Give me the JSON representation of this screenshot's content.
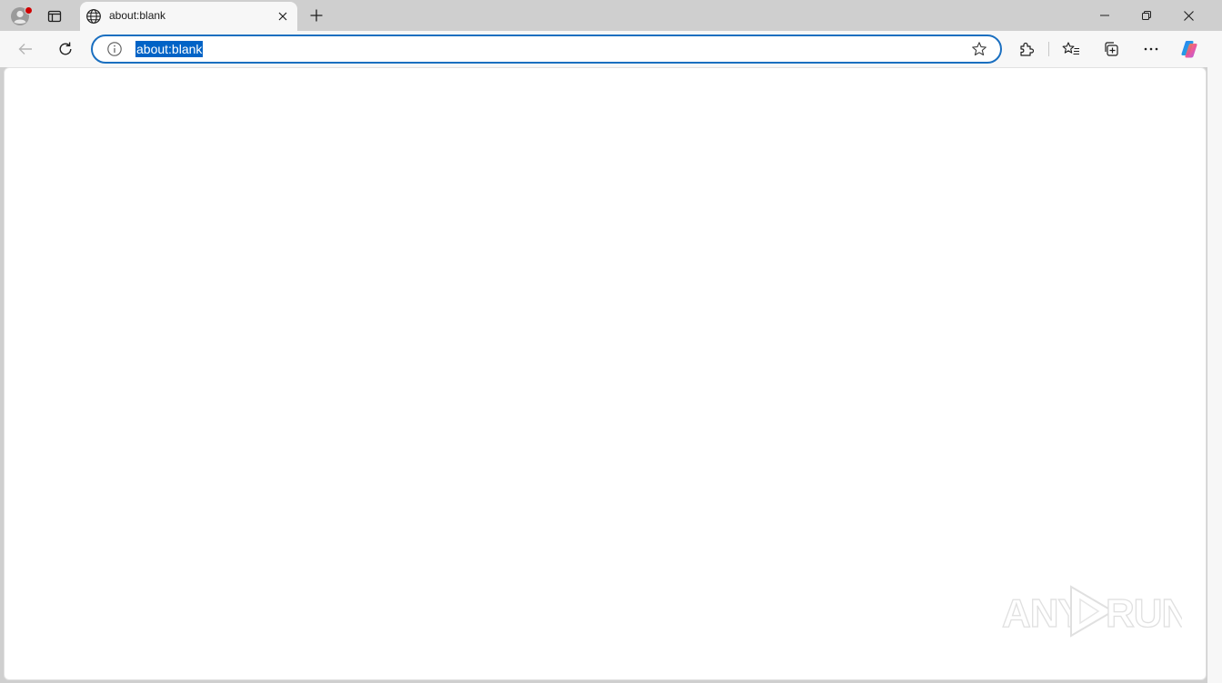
{
  "tab": {
    "title": "about:blank",
    "favicon": "globe-icon"
  },
  "address_bar": {
    "url": "about:blank",
    "selected": true
  },
  "toolbar": {
    "buttons": [
      "back-icon",
      "refresh-icon",
      "extensions-icon",
      "favorites-icon",
      "collections-icon",
      "more-icon",
      "copilot-icon"
    ]
  },
  "watermark": {
    "text_left": "ANY",
    "text_right": "RUN"
  },
  "colors": {
    "frame": "#cfcfcf",
    "toolbar": "#f7f7f7",
    "accent": "#1a6fc0",
    "selection": "#0063c6",
    "profile_badge": "#d00000"
  }
}
